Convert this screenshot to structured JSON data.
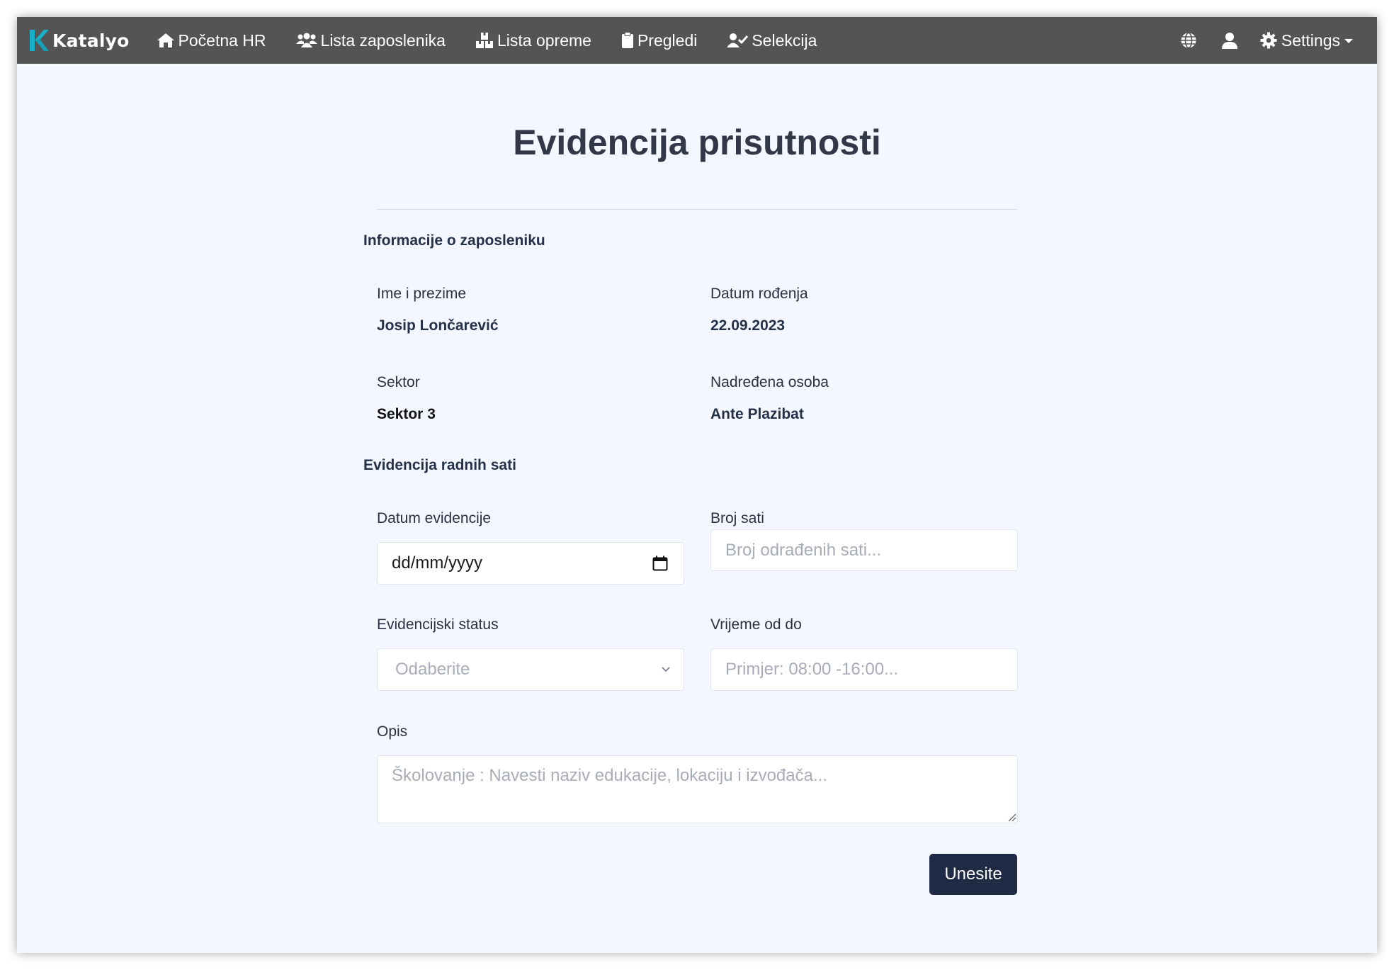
{
  "navbar": {
    "brand": "Katalyo",
    "items": [
      {
        "label": "Početna HR",
        "icon": "home-icon"
      },
      {
        "label": "Lista zaposlenika",
        "icon": "users-icon"
      },
      {
        "label": "Lista opreme",
        "icon": "boxes-icon"
      },
      {
        "label": "Pregledi",
        "icon": "clipboard-icon"
      },
      {
        "label": "Selekcija",
        "icon": "user-check-icon"
      }
    ],
    "right_icons": [
      "globe-icon",
      "user-icon"
    ],
    "settings_label": "Settings",
    "settings_icon": "gear-icon"
  },
  "page": {
    "title": "Evidencija prisutnosti"
  },
  "employee_info": {
    "section_title": "Informacije o zaposleniku",
    "name_label": "Ime i prezime",
    "name_value": "Josip Lončarević",
    "dob_label": "Datum rođenja",
    "dob_value": "22.09.2023",
    "sector_label": "Sektor",
    "sector_value": "Sektor 3",
    "supervisor_label": "Nadređena osoba",
    "supervisor_value": "Ante Plazibat"
  },
  "hours_form": {
    "section_title": "Evidencija radnih sati",
    "date_label": "Datum evidencije",
    "date_placeholder": "dd/mm/yyyy",
    "hours_label": "Broj sati",
    "hours_placeholder": "Broj odrađenih sati...",
    "status_label": "Evidencijski status",
    "status_selected": "Odaberite",
    "time_label": "Vrijeme od do",
    "time_placeholder": "Primjer: 08:00 -16:00...",
    "description_label": "Opis",
    "description_placeholder": "Školovanje : Navesti naziv edukacije, lokaciju i izvođača...",
    "submit_label": "Unesite"
  },
  "colors": {
    "navbar_bg": "#545454",
    "page_bg": "#f4f7ff",
    "brand_accent": "#1ab0c8",
    "submit_bg": "#1f2a44"
  }
}
